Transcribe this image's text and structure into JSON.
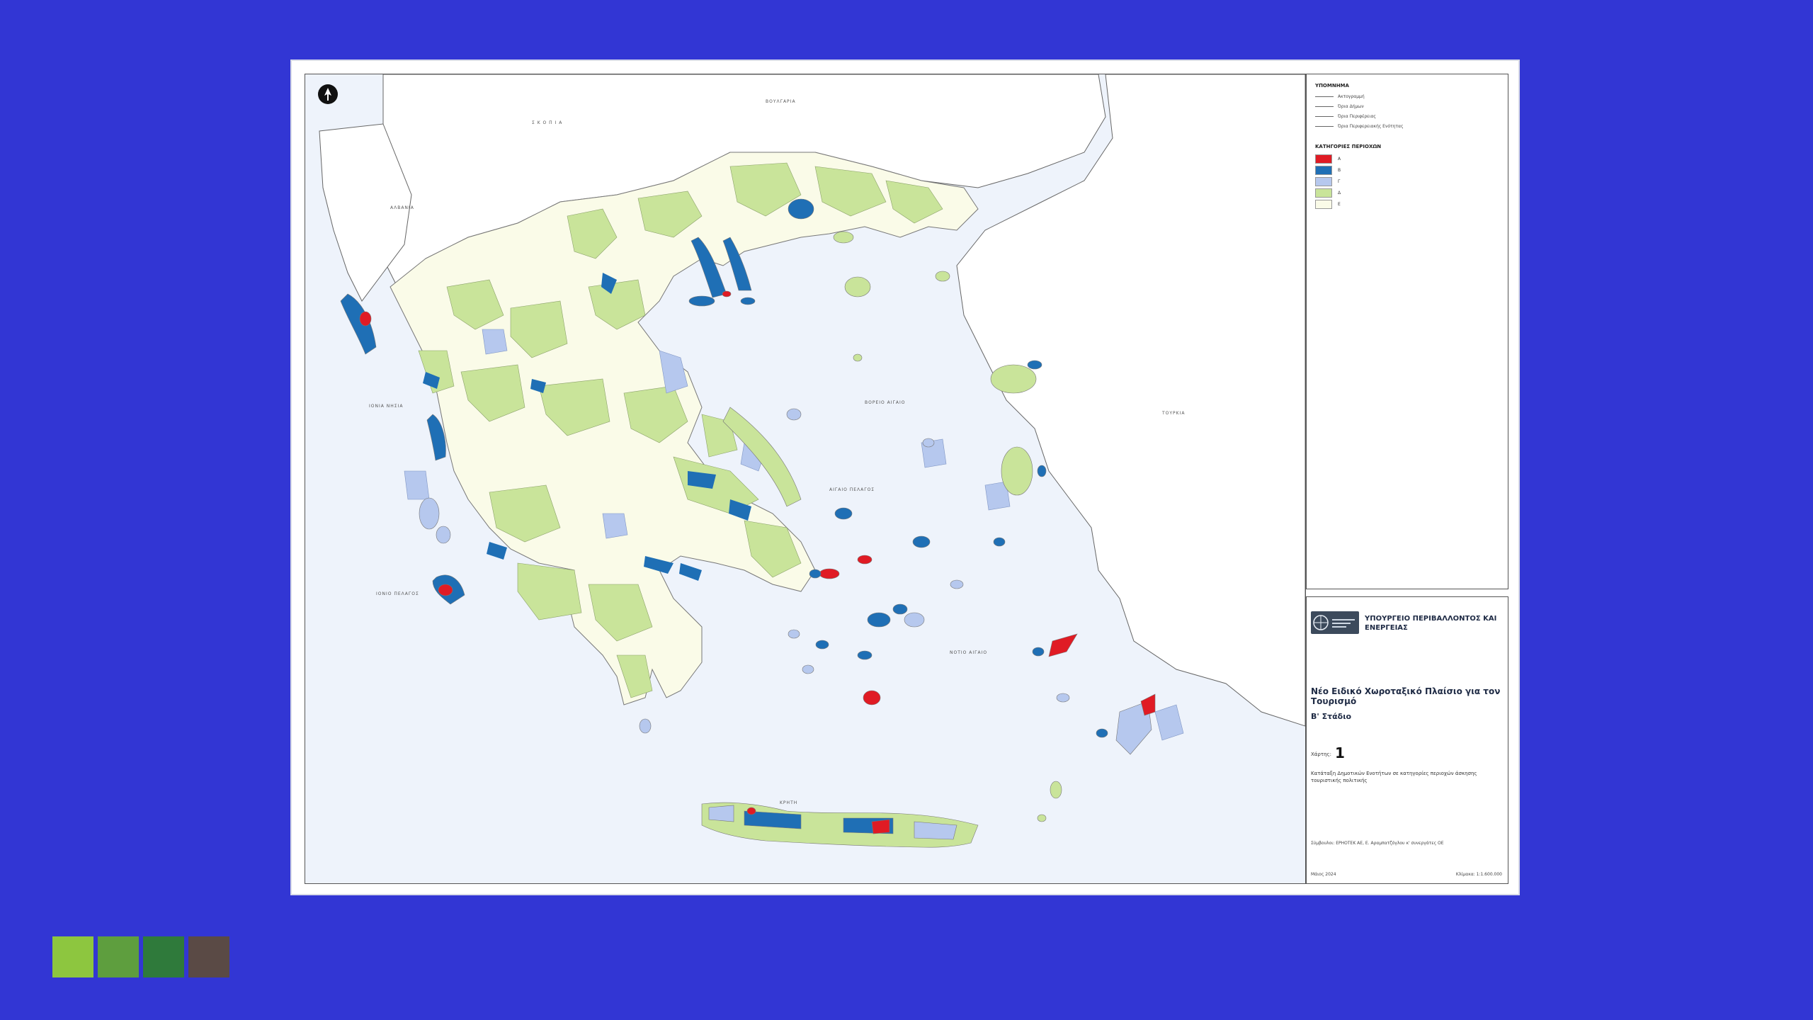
{
  "legend": {
    "lines_heading": "ΥΠΟΜΝΗΜΑ",
    "line_items": [
      "Ακτογραμμή",
      "Όρια Δήμων",
      "Όρια Περιφέρειας",
      "Όρια Περιφερειακής Ενότητας"
    ],
    "categories_heading": "ΚΑΤΗΓΟΡΙΕΣ ΠΕΡΙΟΧΩΝ",
    "categories": [
      {
        "label": "Α",
        "color": "#e01b24"
      },
      {
        "label": "Β",
        "color": "#1f6fb5"
      },
      {
        "label": "Γ",
        "color": "#b6c8ee"
      },
      {
        "label": "Δ",
        "color": "#c9e49a"
      },
      {
        "label": "Ε",
        "color": "#fafbe8"
      }
    ]
  },
  "title_block": {
    "ministry": "ΥΠΟΥΡΓΕΙΟ ΠΕΡΙΒΑΛΛΟΝΤΟΣ ΚΑΙ ΕΝΕΡΓΕΙΑΣ",
    "title": "Νέο Ειδικό Χωροταξικό Πλαίσιο για τον Τουρισμό",
    "stage": "Β' Στάδιο",
    "map_number_label": "Χάρτης:",
    "map_number": "1",
    "description": "Κατάταξη Δημοτικών Ενοτήτων σε κατηγορίες περιοχών άσκησης τουριστικής πολιτικής",
    "credits": "Σύμβουλοι: ΕΡΗΟΤΕΚ ΑΕ, Ε. Αραμπατζόγλου κ' συνεργάτες ΟΕ",
    "date": "Μάιος 2024",
    "scale": "Κλίμακα: 1:1.600.000"
  },
  "map_labels": {
    "bulgaria": "ΒΟΥΛΓΑΡΙΑ",
    "skopje": "Σ Κ Ο Π Ι Α",
    "albania": "ΑΛΒΑΝΙΑ",
    "turkey": "ΤΟΥΡΚΙΑ",
    "aegean": "ΑΙΓΑΙΟ ΠΕΛΑΓΟΣ",
    "ionian": "ΙΟΝΙΟ ΠΕΛΑΓΟΣ",
    "ionian_islands": "ΙΟΝΙΑ ΝΗΣΙΑ",
    "north_aegean": "ΒΟΡΕΙΟ ΑΙΓΑΙΟ",
    "south_aegean": "ΝΟΤΙΟ ΑΙΓΑΙΟ",
    "crete": "ΚΡΗΤΗ"
  },
  "colors": {
    "background": "#3236d4",
    "sea": "#eef3fb",
    "land_neighbor": "#ffffff",
    "green": "#c9e49a",
    "blue": "#1f6fb5",
    "lightblue": "#b6c8ee",
    "red": "#e01b24"
  },
  "decor_squares": [
    "#8dc63f",
    "#5e9e3e",
    "#2f7a3b",
    "#5a4a45"
  ],
  "north_arrow_icon": "north-arrow-icon"
}
